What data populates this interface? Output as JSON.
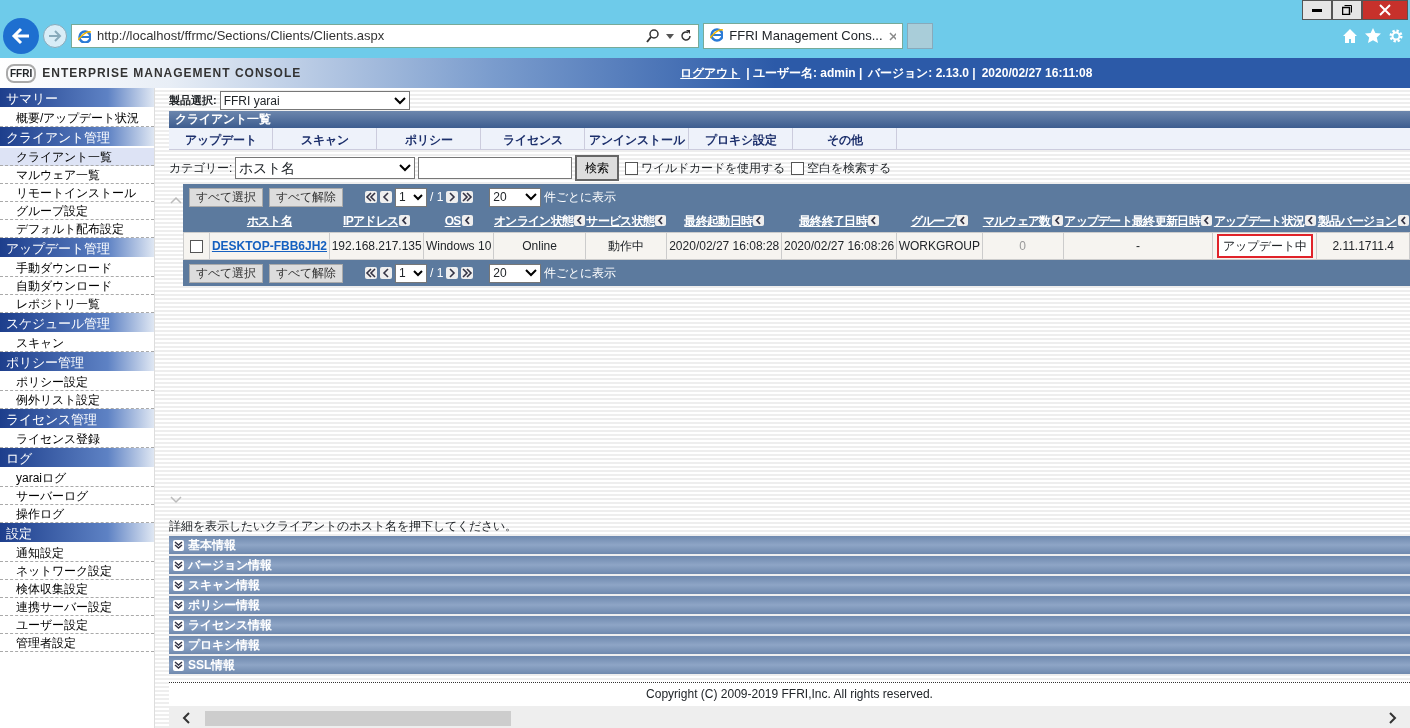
{
  "browser": {
    "url": "http://localhost/ffrmc/Sections/Clients/Clients.aspx",
    "tab_title": "FFRI Management Cons..."
  },
  "header": {
    "logo": "FFRI",
    "title": "ENTERPRISE MANAGEMENT CONSOLE",
    "logout": "ログアウト",
    "user": "| ユーザー名: admin |",
    "version": "バージョン: 2.13.0 |",
    "datetime": "2020/02/27 16:11:08"
  },
  "sidebar": [
    {
      "title": "サマリー",
      "items": [
        {
          "label": "概要/アップデート状況",
          "selected": false
        }
      ]
    },
    {
      "title": "クライアント管理",
      "items": [
        {
          "label": "クライアント一覧",
          "selected": true
        },
        {
          "label": "マルウェア一覧",
          "selected": false
        },
        {
          "label": "リモートインストール",
          "selected": false
        },
        {
          "label": "グループ設定",
          "selected": false
        },
        {
          "label": "デフォルト配布設定",
          "selected": false
        }
      ]
    },
    {
      "title": "アップデート管理",
      "items": [
        {
          "label": "手動ダウンロード",
          "selected": false
        },
        {
          "label": "自動ダウンロード",
          "selected": false
        },
        {
          "label": "レポジトリ一覧",
          "selected": false
        }
      ]
    },
    {
      "title": "スケジュール管理",
      "items": [
        {
          "label": "スキャン",
          "selected": false
        }
      ]
    },
    {
      "title": "ポリシー管理",
      "items": [
        {
          "label": "ポリシー設定",
          "selected": false
        },
        {
          "label": "例外リスト設定",
          "selected": false
        }
      ]
    },
    {
      "title": "ライセンス管理",
      "items": [
        {
          "label": "ライセンス登録",
          "selected": false
        }
      ]
    },
    {
      "title": "ログ",
      "items": [
        {
          "label": "yaraiログ",
          "selected": false
        },
        {
          "label": "サーバーログ",
          "selected": false
        },
        {
          "label": "操作ログ",
          "selected": false
        }
      ]
    },
    {
      "title": "設定",
      "items": [
        {
          "label": "通知設定",
          "selected": false
        },
        {
          "label": "ネットワーク設定",
          "selected": false
        },
        {
          "label": "検体収集設定",
          "selected": false
        },
        {
          "label": "連携サーバー設定",
          "selected": false
        },
        {
          "label": "ユーザー設定",
          "selected": false
        },
        {
          "label": "管理者設定",
          "selected": false
        }
      ]
    }
  ],
  "product": {
    "label": "製品選択:",
    "value": "FFRI yarai"
  },
  "section_title": "クライアント一覧",
  "tabs": [
    "アップデート",
    "スキャン",
    "ポリシー",
    "ライセンス",
    "アンインストール",
    "プロキシ設定",
    "その他"
  ],
  "search": {
    "label": "カテゴリー:",
    "category": "ホスト名",
    "button": "検索",
    "options": [
      {
        "label": "ワイルドカードを使用する",
        "checked": false
      },
      {
        "label": "空白を検索する",
        "checked": false
      }
    ]
  },
  "pagers": [
    {
      "select_all": "すべて選択",
      "deselect_all": "すべて解除",
      "page": "1",
      "total": "/ 1",
      "per_page": "20",
      "per_page_label": "件ごとに表示"
    },
    {
      "select_all": "すべて選択",
      "deselect_all": "すべて解除",
      "page": "1",
      "total": "/ 1",
      "per_page": "20",
      "per_page_label": "件ごとに表示"
    }
  ],
  "table": {
    "columns": [
      {
        "label": "ホスト名",
        "sortable": false
      },
      {
        "label": "IPアドレス",
        "sortable": true
      },
      {
        "label": "OS",
        "sortable": true
      },
      {
        "label": "オンライン状態",
        "sortable": true
      },
      {
        "label": "サービス状態",
        "sortable": true
      },
      {
        "label": "最終起動日時",
        "sortable": true
      },
      {
        "label": "最終終了日時",
        "sortable": true
      },
      {
        "label": "グループ",
        "sortable": true
      },
      {
        "label": "マルウェア数",
        "sortable": true
      },
      {
        "label": "アップデート最終更新日時",
        "sortable": true
      },
      {
        "label": "アップデート状況",
        "sortable": true
      },
      {
        "label": "製品バージョン",
        "sortable": true
      }
    ],
    "rows": [
      {
        "checked": false,
        "cells": [
          "DESKTOP-FBB6JH2",
          "192.168.217.135",
          "Windows 10",
          "Online",
          "動作中",
          "2020/02/27 16:08:28",
          "2020/02/27 16:08:26",
          "WORKGROUP",
          "0",
          "-",
          "アップデート中",
          "2.11.1711.4"
        ]
      }
    ]
  },
  "hint": "詳細を表示したいクライアントのホスト名を押下してください。",
  "panels": [
    {
      "title": "基本情報",
      "expanded": false
    },
    {
      "title": "バージョン情報",
      "expanded": false
    },
    {
      "title": "スキャン情報",
      "expanded": false
    },
    {
      "title": "ポリシー情報",
      "expanded": false
    },
    {
      "title": "ライセンス情報",
      "expanded": false
    },
    {
      "title": "プロキシ情報",
      "expanded": false
    },
    {
      "title": "SSL情報",
      "expanded": false
    }
  ],
  "copyright": "Copyright (C) 2009-2019 FFRI,Inc. All rights reserved."
}
